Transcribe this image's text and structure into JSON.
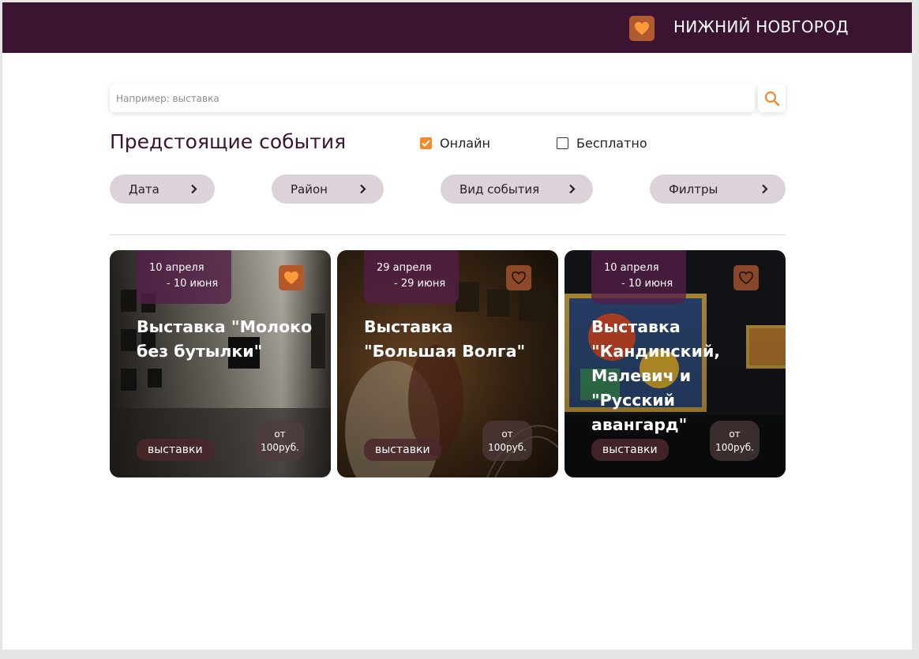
{
  "header": {
    "city": "НИЖНИЙ НОВГОРОД",
    "logo_icon": "heart-icon"
  },
  "search": {
    "placeholder": "Например: выставка",
    "value": "",
    "icon": "search-icon"
  },
  "section": {
    "title": "Предстоящие события"
  },
  "checkboxes": {
    "online": {
      "label": "Онлайн",
      "checked": true
    },
    "free": {
      "label": "Бесплатно",
      "checked": false
    }
  },
  "filters": {
    "date": "Дата",
    "area": "Район",
    "type": "Вид события",
    "more": "Филтры"
  },
  "cards": [
    {
      "date_from": "10 апреля",
      "date_to": "- 10 июня",
      "title": "Выставка \"Молоко без бутылки\"",
      "tag": "выставки",
      "price_prefix": "от",
      "price": "100руб.",
      "favorite": true
    },
    {
      "date_from": "29 апреля",
      "date_to": "- 29 июня",
      "title": "Выставка \"Большая Волга\"",
      "tag": "выставки",
      "price_prefix": "от",
      "price": "100руб.",
      "favorite": false
    },
    {
      "date_from": "10 апреля",
      "date_to": "- 10 июня",
      "title": "Выставка \"Кандинский, Малевич и \"Русский авангард\"",
      "tag": "выставки",
      "price_prefix": "от",
      "price": "100руб.",
      "favorite": false
    }
  ],
  "colors": {
    "header_bg": "#3b1431",
    "accent": "#f08a2b",
    "pill_bg": "#dcd3da",
    "title": "#3b1431"
  }
}
